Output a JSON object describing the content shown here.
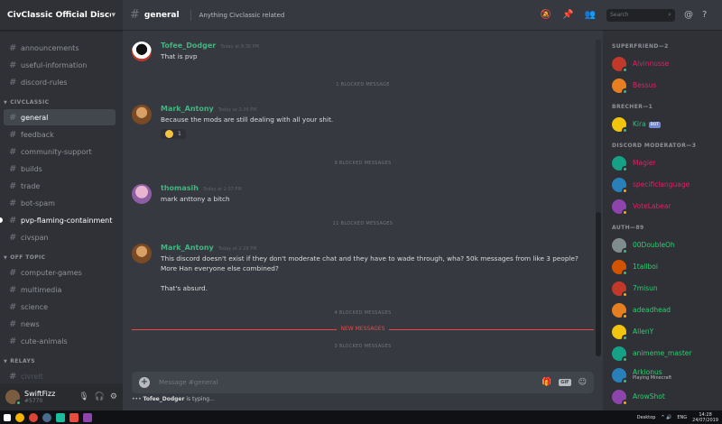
{
  "server": {
    "name": "CivClassic Official Discord"
  },
  "channels": {
    "top": [
      {
        "name": "announcements"
      },
      {
        "name": "useful-information"
      },
      {
        "name": "discord-rules"
      }
    ],
    "categories": [
      {
        "name": "CIVCLASSIC",
        "items": [
          {
            "name": "general",
            "state": "active"
          },
          {
            "name": "feedback",
            "state": "read"
          },
          {
            "name": "community-support",
            "state": "read"
          },
          {
            "name": "builds",
            "state": "read"
          },
          {
            "name": "trade",
            "state": "read"
          },
          {
            "name": "bot-spam",
            "state": "read"
          },
          {
            "name": "pvp-flaming-containment",
            "state": "unread"
          },
          {
            "name": "civspan",
            "state": "read"
          }
        ]
      },
      {
        "name": "OFF TOPIC",
        "items": [
          {
            "name": "computer-games"
          },
          {
            "name": "multimedia"
          },
          {
            "name": "science"
          },
          {
            "name": "news"
          },
          {
            "name": "cute-animals"
          }
        ]
      },
      {
        "name": "RELAYS",
        "items": [
          {
            "name": "civrelt"
          }
        ]
      }
    ]
  },
  "user": {
    "name": "SwiftFizz",
    "tag": "#5770"
  },
  "header": {
    "channel": "general",
    "topic": "Anything Civclassic related",
    "search_placeholder": "Search"
  },
  "messages": [
    {
      "author": "Tofee_Dodger",
      "time": "Today at 8:36 PM",
      "lines": [
        "That is pvp"
      ]
    },
    {
      "blocked": "1 BLOCKED MESSAGE"
    },
    {
      "author": "Mark_Antony",
      "time": "Today at 2:36 PM",
      "lines": [
        "Because the mods are still dealing with all your shit."
      ],
      "reaction": {
        "count": "1"
      }
    },
    {
      "blocked": "9 BLOCKED MESSAGES"
    },
    {
      "author": "thomasih",
      "time": "Today at 2:37 PM",
      "lines": [
        "mark anttony a bitch"
      ]
    },
    {
      "blocked": "11 BLOCKED MESSAGES"
    },
    {
      "author": "Mark_Antony",
      "time": "Today at 2:28 PM",
      "lines": [
        "This discord doesn't exist if they don't moderate chat and they have to wade through, wha? 50k messages from like 3 people? More Han everyone else combined?",
        "That's absurd."
      ]
    },
    {
      "blocked": "4 BLOCKED MESSAGES"
    },
    {
      "new_messages": "NEW MESSAGES"
    },
    {
      "blocked": "3 BLOCKED MESSAGES"
    }
  ],
  "composer": {
    "placeholder": "Message #general"
  },
  "typing": {
    "user": "Tofee_Dodger",
    "text": "is typing..."
  },
  "member_groups": [
    {
      "title": "SUPERFRIEND—2",
      "members": [
        {
          "name": "Alvinnusse",
          "color": "#e91e63",
          "status": "online"
        },
        {
          "name": "Bessus",
          "color": "#e91e63",
          "status": "online"
        }
      ]
    },
    {
      "title": "BRECHER—1",
      "members": [
        {
          "name": "Kira",
          "color": "#43b581",
          "status": "online",
          "bot": "BOT"
        }
      ]
    },
    {
      "title": "DISCORD MODERATOR—3",
      "members": [
        {
          "name": "Magier",
          "color": "#e91e63",
          "status": "online"
        },
        {
          "name": "specificlanguage",
          "color": "#e91e63",
          "status": "idle"
        },
        {
          "name": "VoteLabear",
          "color": "#e91e63",
          "status": "idle"
        }
      ]
    },
    {
      "title": "AUTH—89",
      "members": [
        {
          "name": "00DoubleOh",
          "color": "#2ecc71",
          "status": "online"
        },
        {
          "name": "1tallboi",
          "color": "#2ecc71",
          "status": "online"
        },
        {
          "name": "7misun",
          "color": "#2ecc71",
          "status": "idle"
        },
        {
          "name": "adeadhead",
          "color": "#2ecc71",
          "status": "idle"
        },
        {
          "name": "AllenY",
          "color": "#2ecc71",
          "status": "online"
        },
        {
          "name": "animeme_master",
          "color": "#2ecc71",
          "status": "online"
        },
        {
          "name": "Arkionus",
          "color": "#2ecc71",
          "status": "online",
          "activity": "Playing Minecraft"
        },
        {
          "name": "ArowShot",
          "color": "#2ecc71",
          "status": "idle"
        }
      ]
    }
  ],
  "taskbar": {
    "desktop": "Desktop",
    "lang": "ENG",
    "time": "14:28",
    "date": "24/07/2019"
  },
  "colors": {
    "accent": "#43b581",
    "mod": "#e91e63",
    "danger": "#f04747",
    "online": "#43b581",
    "idle": "#faa61a"
  }
}
